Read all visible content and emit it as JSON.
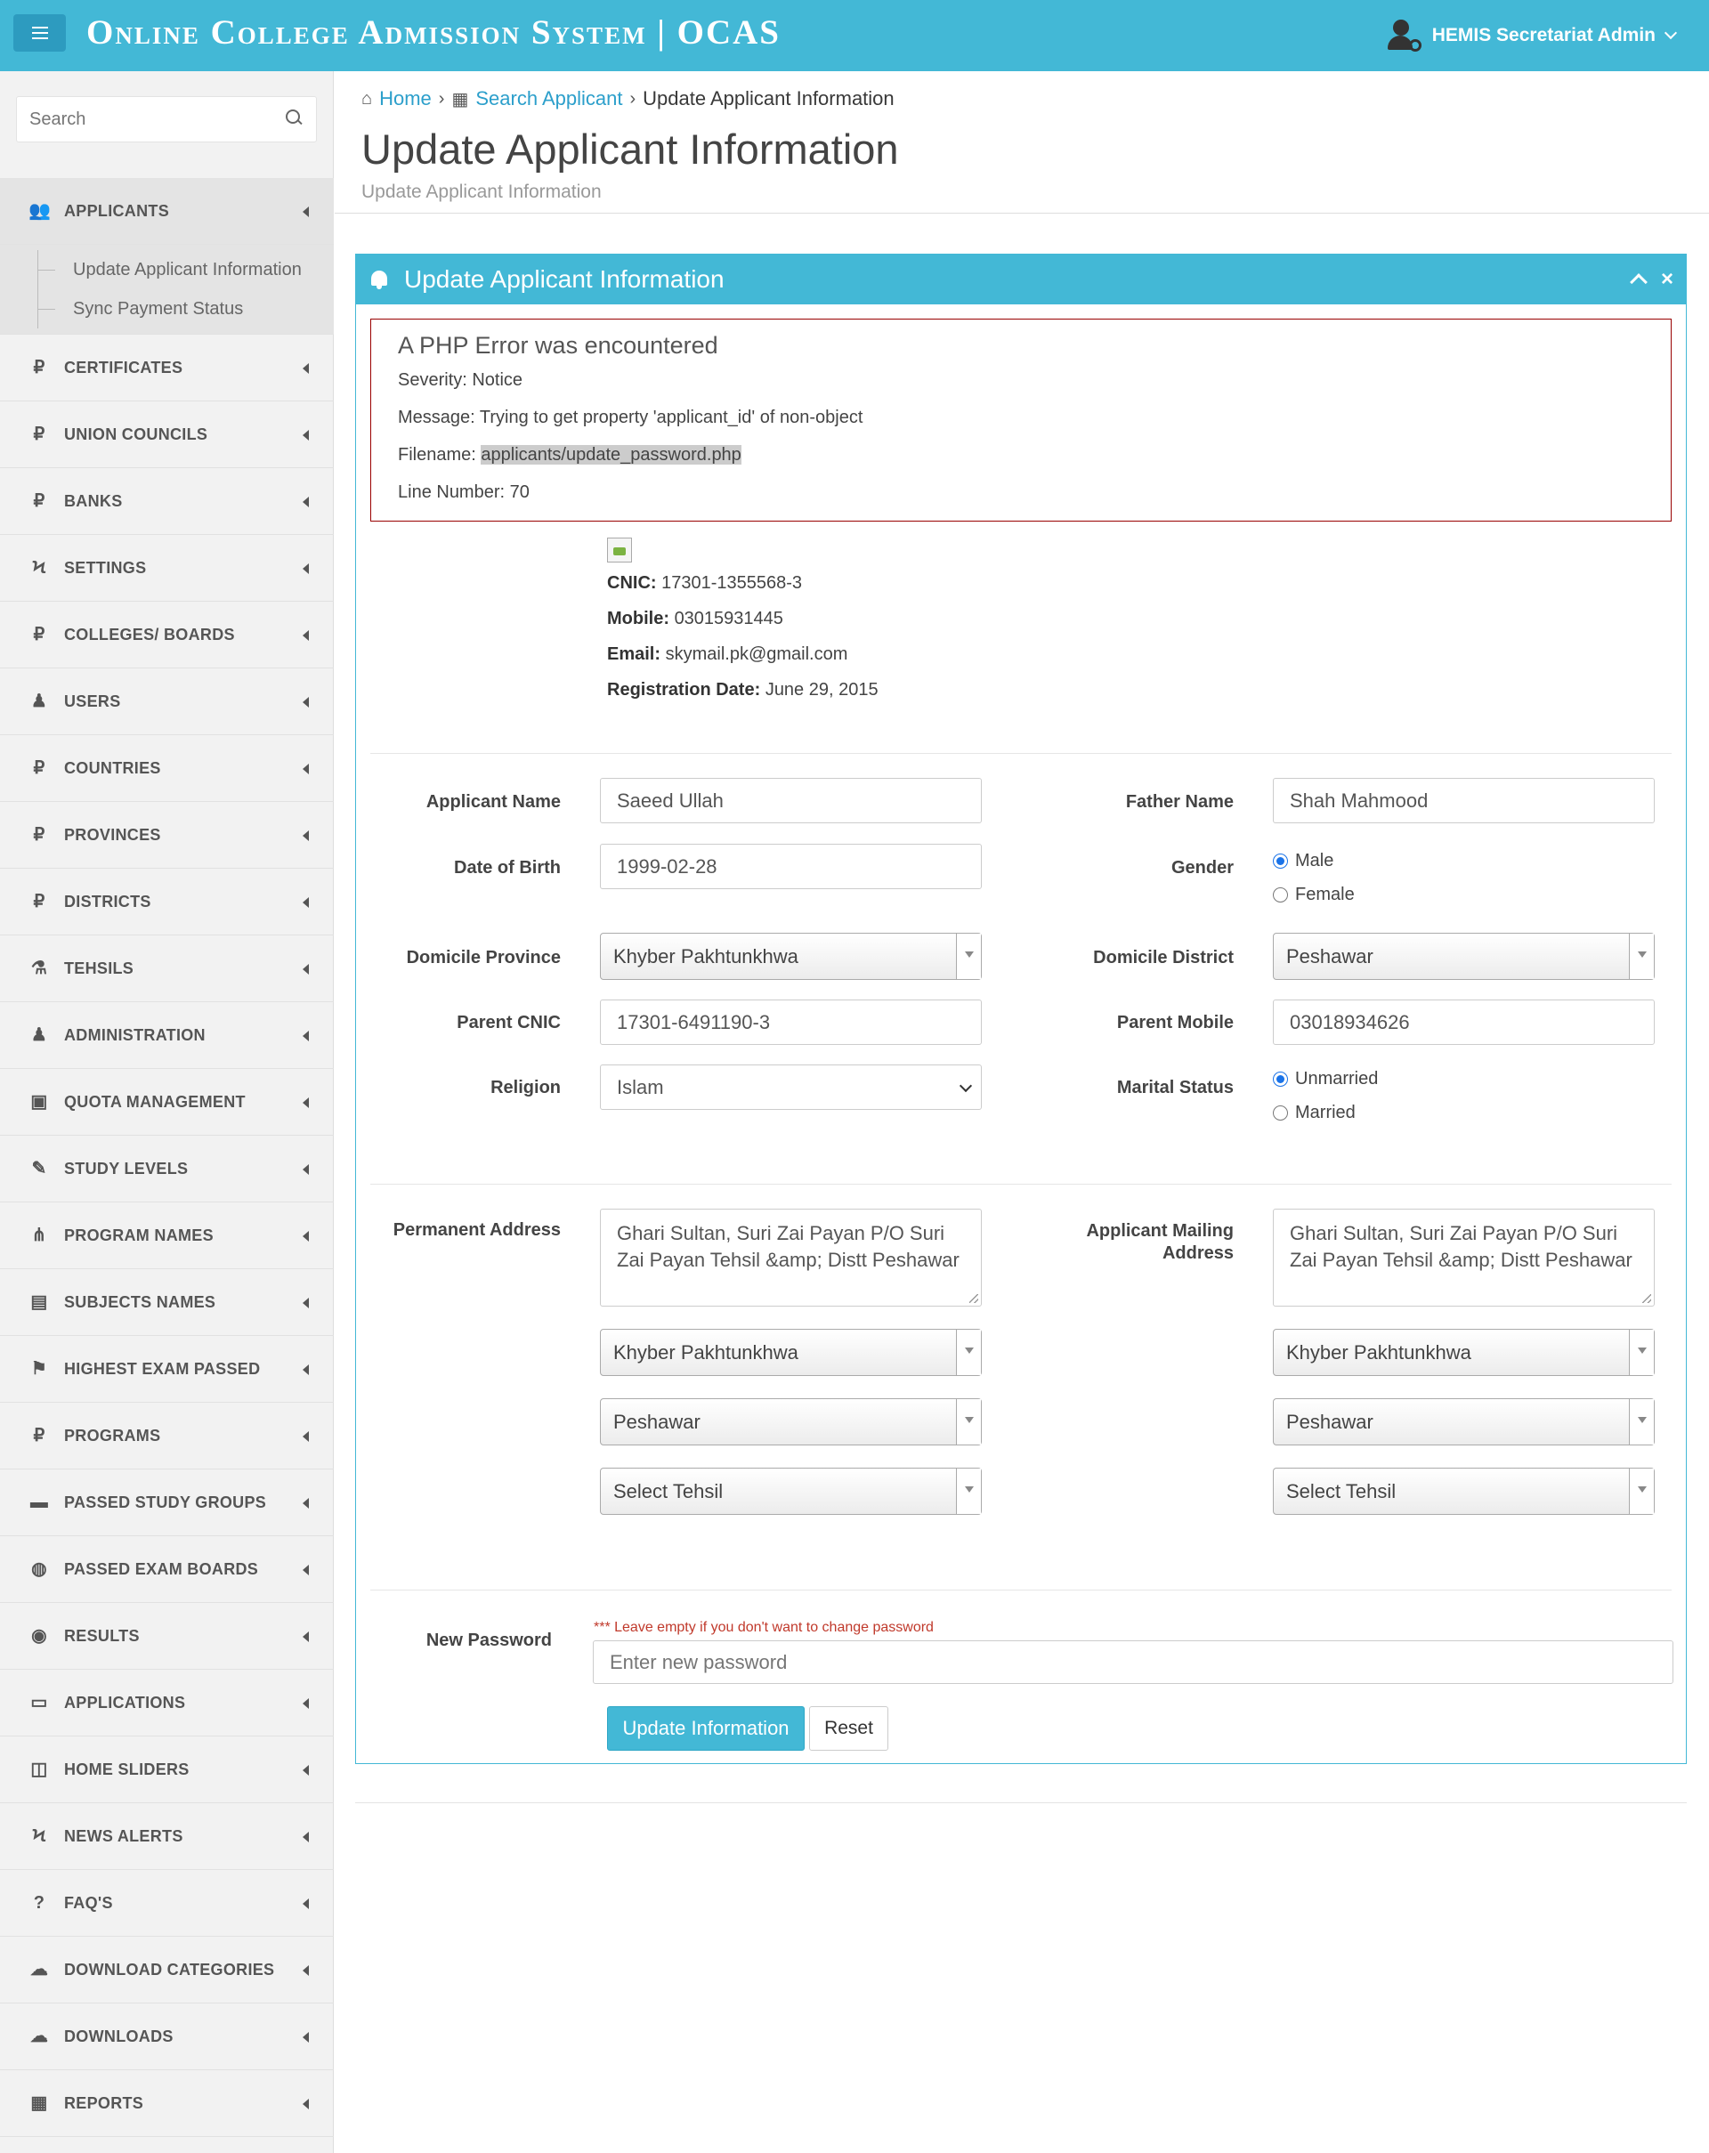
{
  "header": {
    "brand": "Online College Admission System | OCAS",
    "user": "HEMIS Secretariat Admin",
    "colors": {
      "primary": "#43b8d6",
      "error_border": "#990000",
      "hint": "#c0392b"
    }
  },
  "sidebar": {
    "search_placeholder": "Search",
    "items": [
      {
        "label": "APPLICANTS",
        "icon": "users-icon"
      },
      {
        "label": "CERTIFICATES",
        "icon": "ruble-icon"
      },
      {
        "label": "UNION COUNCILS",
        "icon": "ruble-icon"
      },
      {
        "label": "BANKS",
        "icon": "ruble-icon"
      },
      {
        "label": "SETTINGS",
        "icon": "bolt-icon"
      },
      {
        "label": "COLLEGES/ BOARDS",
        "icon": "ruble-icon"
      },
      {
        "label": "USERS",
        "icon": "user-secret-icon"
      },
      {
        "label": "COUNTRIES",
        "icon": "ruble-icon"
      },
      {
        "label": "PROVINCES",
        "icon": "ruble-icon"
      },
      {
        "label": "DISTRICTS",
        "icon": "ruble-icon"
      },
      {
        "label": "TEHSILS",
        "icon": "flask-icon"
      },
      {
        "label": "ADMINISTRATION",
        "icon": "user-secret-icon"
      },
      {
        "label": "QUOTA MANAGEMENT",
        "icon": "vimeo-icon"
      },
      {
        "label": "STUDY LEVELS",
        "icon": "magic-icon"
      },
      {
        "label": "PROGRAM NAMES",
        "icon": "cutlery-icon"
      },
      {
        "label": "SUBJECTS NAMES",
        "icon": "book-icon"
      },
      {
        "label": "HIGHEST EXAM PASSED",
        "icon": "flag-checkered-icon"
      },
      {
        "label": "PROGRAMS",
        "icon": "ruble-icon"
      },
      {
        "label": "PASSED STUDY GROUPS",
        "icon": "folder-icon"
      },
      {
        "label": "PASSED EXAM BOARDS",
        "icon": "globe-icon"
      },
      {
        "label": "RESULTS",
        "icon": "arrow-circle-icon"
      },
      {
        "label": "APPLICATIONS",
        "icon": "briefcase-icon"
      },
      {
        "label": "HOME SLIDERS",
        "icon": "gamepad-icon"
      },
      {
        "label": "NEWS ALERTS",
        "icon": "bolt-icon"
      },
      {
        "label": "FAQ'S",
        "icon": "question-icon"
      },
      {
        "label": "DOWNLOAD CATEGORIES",
        "icon": "cloud-icon"
      },
      {
        "label": "DOWNLOADS",
        "icon": "cloud-download-icon"
      },
      {
        "label": "REPORTS",
        "icon": "calendar-icon"
      }
    ],
    "submenu": [
      "Update Applicant Information",
      "Sync Payment Status"
    ]
  },
  "breadcrumb": {
    "home": "Home",
    "search": "Search Applicant",
    "current": "Update Applicant Information"
  },
  "page": {
    "title": "Update Applicant Information",
    "subtitle": "Update Applicant Information"
  },
  "panel": {
    "title": "Update Applicant Information"
  },
  "error": {
    "heading": "A PHP Error was encountered",
    "severity": "Severity: Notice",
    "message": "Message: Trying to get property 'applicant_id' of non-object",
    "filename_label": "Filename: ",
    "filename": "applicants/update_password.php",
    "line": "Line Number: 70"
  },
  "profile": {
    "cnic_label": "CNIC:",
    "cnic": "17301-1355568-3",
    "mobile_label": "Mobile:",
    "mobile": "03015931445",
    "email_label": "Email:",
    "email": "skymail.pk@gmail.com",
    "reg_label": "Registration Date:",
    "reg": "June 29, 2015"
  },
  "form": {
    "applicant_name_label": "Applicant Name",
    "applicant_name": "Saeed Ullah",
    "father_name_label": "Father Name",
    "father_name": "Shah Mahmood",
    "dob_label": "Date of Birth",
    "dob": "1999-02-28",
    "gender_label": "Gender",
    "gender_male": "Male",
    "gender_female": "Female",
    "domicile_province_label": "Domicile Province",
    "domicile_province": "Khyber Pakhtunkhwa",
    "domicile_district_label": "Domicile District",
    "domicile_district": "Peshawar",
    "parent_cnic_label": "Parent CNIC",
    "parent_cnic": "17301-6491190-3",
    "parent_mobile_label": "Parent Mobile",
    "parent_mobile": "03018934626",
    "religion_label": "Religion",
    "religion": "Islam",
    "marital_label": "Marital Status",
    "marital_unmarried": "Unmarried",
    "marital_married": "Married",
    "permanent_address_label": "Permanent Address",
    "permanent_address": "Ghari Sultan, Suri Zai Payan P/O Suri Zai Payan Tehsil &amp; Distt Peshawar",
    "mailing_address_label": "Applicant Mailing Address",
    "mailing_address": "Ghari Sultan, Suri Zai Payan P/O Suri Zai Payan Tehsil &amp; Distt Peshawar",
    "perm_province": "Khyber Pakhtunkhwa",
    "perm_district": "Peshawar",
    "perm_tehsil": "Select Tehsil",
    "mail_province": "Khyber Pakhtunkhwa",
    "mail_district": "Peshawar",
    "mail_tehsil": "Select Tehsil",
    "password_label": "New Password",
    "password_hint": "*** Leave empty if you don't want to change password",
    "password_placeholder": "Enter new password",
    "submit": "Update Information",
    "reset": "Reset"
  }
}
